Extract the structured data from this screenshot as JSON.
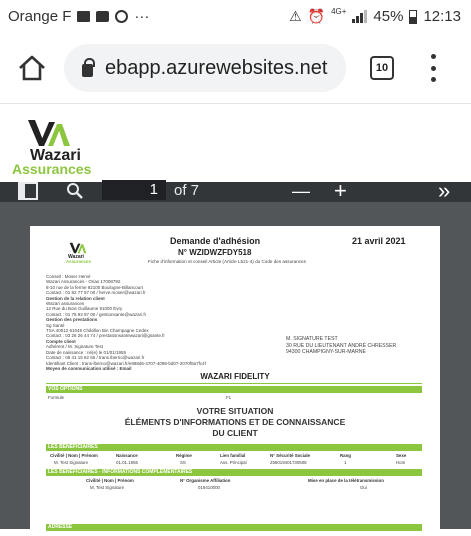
{
  "status_bar": {
    "carrier": "Orange F",
    "more": "···",
    "network": "4G+",
    "battery": "45%",
    "time": "12:13"
  },
  "browser": {
    "url": "ebapp.azurewebsites.net",
    "tab_count": "10"
  },
  "site": {
    "brand": "Wazari",
    "brand_sub": "Assurances"
  },
  "pdf_toolbar": {
    "page_current": "1",
    "page_total": "of 7",
    "zoom_out": "—",
    "zoom_in": "+",
    "more": "»"
  },
  "document": {
    "logo_brand": "Wazari",
    "logo_sub": "Assurances",
    "title": "Demande d'adhésion",
    "number": "N° WZIDWZFDY518",
    "date": "21 avril 2021",
    "subtitle": "Fiche d'information et conseil Article (Article L521-4) du Code des assurances",
    "left_block": [
      "Conseil : Moser Hervé",
      "Wazari Assurances - Orias 17008792",
      "8-10 rue de la ferme 92100 Boulogne-Billancourt",
      "Contact : 01 82 77 57 00 / herve.moser@wazari.fr",
      "Gestion de la relation client",
      "Wazari assurances",
      "12 Rue du Bois Guillaume 91000 Évry",
      "Contact : 01 75 93 97 00 / gestionsante@wazari.fr",
      "Gestion des prestations",
      "Sg Santé",
      "TSA 40012 61049 Châtillon Bin Champagne Cedex",
      "Contact : 03 26 26 44 74 / prestationsantewazari@gsante.fr",
      "Compte client",
      "Adhérent / M. Signature Test",
      "Date de naissance : né(e) le 01/01/1955",
      "Contact : 06 41 15 62 55 / trans.lberno@wazari.fr",
      "Identifiant Client : trans-lberno@wazari.fr/e988d6-4707-4098-bd07-2070f8a7fc4f",
      "Moyen de communication utilisé : Email"
    ],
    "address": [
      "M. SIGNATURE TEST",
      "30 RUE DU LIEUTENANT ANDRÉ CHRESSER",
      "94300 CHAMPIGNY-SUR-MARNE"
    ],
    "product": "WAZARI FIDELITY",
    "section_options": "VOS OPTIONS",
    "formula_label": "Formule",
    "formula_value": "F1",
    "situation_title_1": "VOTRE SITUATION",
    "situation_title_2": "ÉLÉMENTS D'INFORMATIONS ET DE CONNAISSANCE",
    "situation_title_3": "DU CLIENT",
    "section_beneficiaires": "LES BÉNÉFICIAIRES",
    "benef_headers": [
      "Civilité | Nom | Prénom",
      "Naissance",
      "Régime",
      "Lien familial",
      "N° Sécurité Sociale",
      "Rang",
      "Sexe"
    ],
    "benef_row": [
      "M. Test Signature",
      "01.01.1955",
      "SS",
      "Ass. Principal",
      "255019401730508",
      "1",
      "Hom"
    ],
    "section_compl": "LES BÉNÉFICIAIRES - INFORMATIONS COMPLÉMENTAIRES",
    "compl_headers": [
      "Civilité | Nom | Prénom",
      "N° Organisme Affiliation",
      "Mise en place de la télétransmission"
    ],
    "compl_row": [
      "M. Test Signature",
      "019410000",
      "Oui"
    ],
    "section_adresse": "ADRESSE"
  }
}
